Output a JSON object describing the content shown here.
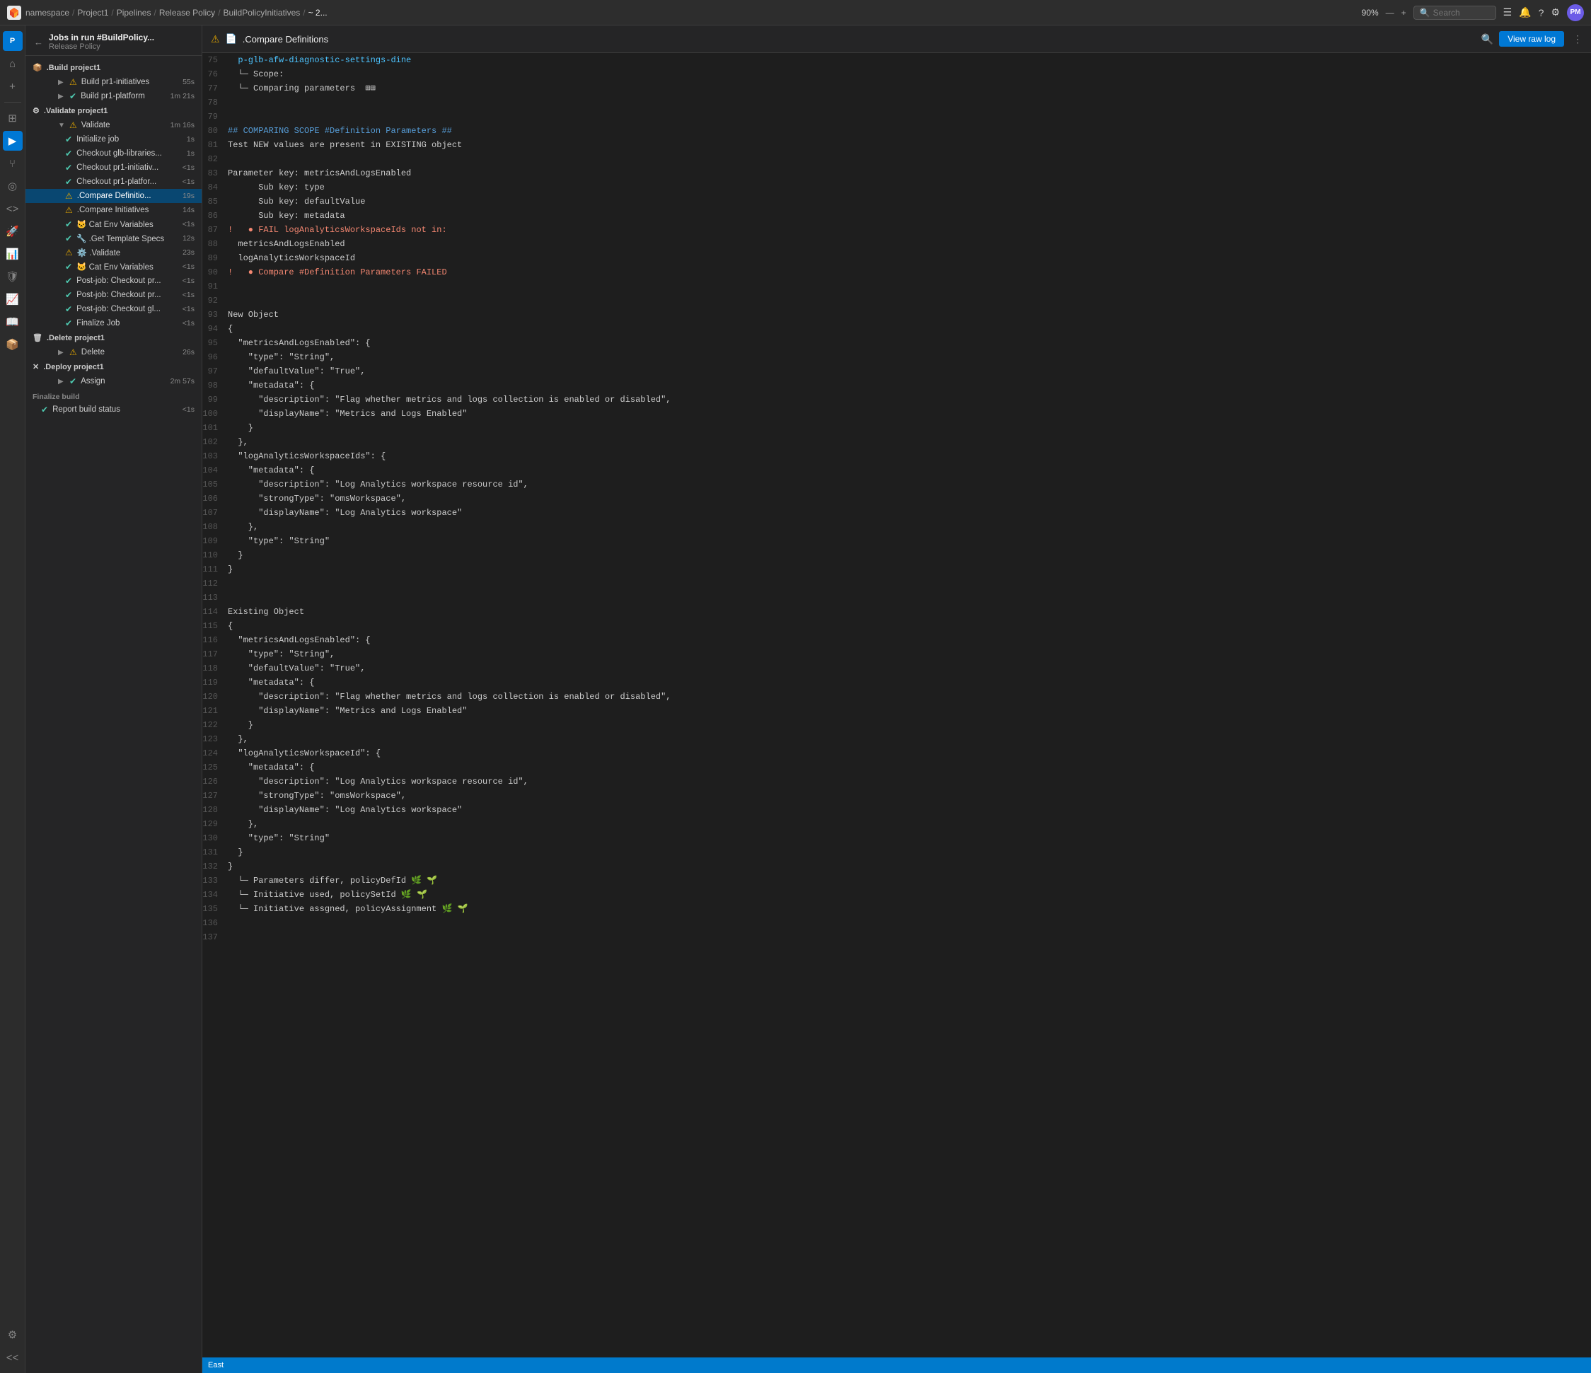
{
  "topbar": {
    "logo": "GL",
    "breadcrumb": [
      {
        "label": "namespace",
        "href": "#"
      },
      {
        "label": "Project1",
        "href": "#"
      },
      {
        "label": "Pipelines",
        "href": "#"
      },
      {
        "label": "Release Policy",
        "href": "#"
      },
      {
        "label": "BuildPolicyInitiatives",
        "href": "#"
      },
      {
        "label": "~ 2...",
        "href": "#"
      }
    ],
    "zoom": "90%",
    "search_placeholder": "Search",
    "avatar": "PM"
  },
  "sidebar": {
    "back_label": "←",
    "title": "Jobs in run #BuildPolicy...",
    "subtitle": "Release Policy",
    "groups": [
      {
        "name": "build_project1",
        "label": ".Build project1",
        "icon": "📦",
        "expanded": false,
        "jobs": [
          {
            "name": "Build pr1-initiatives",
            "status": "warn",
            "duration": "55s",
            "indent": 1
          },
          {
            "name": "Build pr1-platform",
            "status": "ok",
            "duration": "1m 21s",
            "indent": 1
          }
        ]
      },
      {
        "name": "validate_project1",
        "label": ".Validate project1",
        "icon": "⚙️",
        "expanded": true,
        "jobs": [
          {
            "name": "Validate",
            "status": "warn",
            "duration": "1m 16s",
            "indent": 1,
            "expand": true
          },
          {
            "name": "Initialize job",
            "status": "ok",
            "duration": "1s",
            "indent": 2
          },
          {
            "name": "Checkout glb-libraries...",
            "status": "ok",
            "duration": "1s",
            "indent": 2
          },
          {
            "name": "Checkout pr1-initiativ...",
            "status": "ok",
            "duration": "<1s",
            "indent": 2
          },
          {
            "name": "Checkout pr1-platfor...",
            "status": "ok",
            "duration": "<1s",
            "indent": 2
          },
          {
            "name": ".Compare Definitio...",
            "status": "warn",
            "duration": "19s",
            "indent": 2,
            "active": true
          },
          {
            "name": ".Compare Initiatives",
            "status": "warn",
            "duration": "14s",
            "indent": 2
          },
          {
            "name": "🐱 Cat Env Variables",
            "status": "ok",
            "duration": "<1s",
            "indent": 2
          },
          {
            "name": "🔧 .Get Template Specs",
            "status": "ok",
            "duration": "12s",
            "indent": 2
          },
          {
            "name": "⚙️ .Validate",
            "status": "warn",
            "duration": "23s",
            "indent": 2
          },
          {
            "name": "🐱 Cat Env Variables",
            "status": "ok",
            "duration": "<1s",
            "indent": 2
          },
          {
            "name": "Post-job: Checkout pr...",
            "status": "ok",
            "duration": "<1s",
            "indent": 2
          },
          {
            "name": "Post-job: Checkout pr...",
            "status": "ok",
            "duration": "<1s",
            "indent": 2
          },
          {
            "name": "Post-job: Checkout gl...",
            "status": "ok",
            "duration": "<1s",
            "indent": 2
          },
          {
            "name": "Finalize Job",
            "status": "ok",
            "duration": "<1s",
            "indent": 2
          }
        ]
      },
      {
        "name": "delete_project1",
        "label": ".Delete project1",
        "icon": "🗑️",
        "expanded": false,
        "jobs": [
          {
            "name": "Delete",
            "status": "warn",
            "duration": "26s",
            "indent": 1
          }
        ]
      },
      {
        "name": "deploy_project1",
        "label": ".Deploy project1",
        "icon": "✕",
        "expanded": false,
        "jobs": [
          {
            "name": "Assign",
            "status": "ok",
            "duration": "2m 57s",
            "indent": 1
          }
        ]
      }
    ],
    "finalize": {
      "label": "Finalize build",
      "jobs": [
        {
          "name": "Report build status",
          "status": "ok",
          "duration": "<1s"
        }
      ]
    }
  },
  "content": {
    "title": ".Compare Definitions",
    "view_raw_label": "View raw log",
    "lines": [
      {
        "num": 75,
        "text": "  p-glb-afw-diagnostic-settings-dine",
        "style": "link"
      },
      {
        "num": 76,
        "text": "  └─ Scope:",
        "style": "normal"
      },
      {
        "num": 77,
        "text": "  └─ Comparing parameters  ⊞⊞",
        "style": "normal"
      },
      {
        "num": 78,
        "text": "",
        "style": "normal"
      },
      {
        "num": 79,
        "text": "",
        "style": "normal"
      },
      {
        "num": 80,
        "text": "## COMPARING SCOPE #Definition Parameters ##",
        "style": "blue"
      },
      {
        "num": 81,
        "text": "Test NEW values are present in EXISTING object",
        "style": "normal"
      },
      {
        "num": 82,
        "text": "",
        "style": "normal"
      },
      {
        "num": 83,
        "text": "Parameter key: metricsAndLogsEnabled",
        "style": "normal"
      },
      {
        "num": 84,
        "text": "      Sub key: type",
        "style": "normal"
      },
      {
        "num": 85,
        "text": "      Sub key: defaultValue",
        "style": "normal"
      },
      {
        "num": 86,
        "text": "      Sub key: metadata",
        "style": "normal"
      },
      {
        "num": 87,
        "text": "!   ● FAIL logAnalyticsWorkspaceIds not in:",
        "style": "err"
      },
      {
        "num": 88,
        "text": "  metricsAndLogsEnabled",
        "style": "normal"
      },
      {
        "num": 89,
        "text": "  logAnalyticsWorkspaceId",
        "style": "normal"
      },
      {
        "num": 90,
        "text": "!   ● Compare #Definition Parameters FAILED",
        "style": "err"
      },
      {
        "num": 91,
        "text": "",
        "style": "normal"
      },
      {
        "num": 92,
        "text": "",
        "style": "normal"
      },
      {
        "num": 93,
        "text": "New Object",
        "style": "normal"
      },
      {
        "num": 94,
        "text": "{",
        "style": "normal"
      },
      {
        "num": 95,
        "text": "  \"metricsAndLogsEnabled\": {",
        "style": "normal"
      },
      {
        "num": 96,
        "text": "    \"type\": \"String\",",
        "style": "normal"
      },
      {
        "num": 97,
        "text": "    \"defaultValue\": \"True\",",
        "style": "normal"
      },
      {
        "num": 98,
        "text": "    \"metadata\": {",
        "style": "normal"
      },
      {
        "num": 99,
        "text": "      \"description\": \"Flag whether metrics and logs collection is enabled or disabled\",",
        "style": "normal"
      },
      {
        "num": 100,
        "text": "      \"displayName\": \"Metrics and Logs Enabled\"",
        "style": "normal"
      },
      {
        "num": 101,
        "text": "    }",
        "style": "normal"
      },
      {
        "num": 102,
        "text": "  },",
        "style": "normal"
      },
      {
        "num": 103,
        "text": "  \"logAnalyticsWorkspaceIds\": {",
        "style": "normal"
      },
      {
        "num": 104,
        "text": "    \"metadata\": {",
        "style": "normal"
      },
      {
        "num": 105,
        "text": "      \"description\": \"Log Analytics workspace resource id\",",
        "style": "normal"
      },
      {
        "num": 106,
        "text": "      \"strongType\": \"omsWorkspace\",",
        "style": "normal"
      },
      {
        "num": 107,
        "text": "      \"displayName\": \"Log Analytics workspace\"",
        "style": "normal"
      },
      {
        "num": 108,
        "text": "    },",
        "style": "normal"
      },
      {
        "num": 109,
        "text": "    \"type\": \"String\"",
        "style": "normal"
      },
      {
        "num": 110,
        "text": "  }",
        "style": "normal"
      },
      {
        "num": 111,
        "text": "}",
        "style": "normal"
      },
      {
        "num": 112,
        "text": "",
        "style": "normal"
      },
      {
        "num": 113,
        "text": "",
        "style": "normal"
      },
      {
        "num": 114,
        "text": "Existing Object",
        "style": "normal"
      },
      {
        "num": 115,
        "text": "{",
        "style": "normal"
      },
      {
        "num": 116,
        "text": "  \"metricsAndLogsEnabled\": {",
        "style": "normal"
      },
      {
        "num": 117,
        "text": "    \"type\": \"String\",",
        "style": "normal"
      },
      {
        "num": 118,
        "text": "    \"defaultValue\": \"True\",",
        "style": "normal"
      },
      {
        "num": 119,
        "text": "    \"metadata\": {",
        "style": "normal"
      },
      {
        "num": 120,
        "text": "      \"description\": \"Flag whether metrics and logs collection is enabled or disabled\",",
        "style": "normal"
      },
      {
        "num": 121,
        "text": "      \"displayName\": \"Metrics and Logs Enabled\"",
        "style": "normal"
      },
      {
        "num": 122,
        "text": "    }",
        "style": "normal"
      },
      {
        "num": 123,
        "text": "  },",
        "style": "normal"
      },
      {
        "num": 124,
        "text": "  \"logAnalyticsWorkspaceId\": {",
        "style": "normal"
      },
      {
        "num": 125,
        "text": "    \"metadata\": {",
        "style": "normal"
      },
      {
        "num": 126,
        "text": "      \"description\": \"Log Analytics workspace resource id\",",
        "style": "normal"
      },
      {
        "num": 127,
        "text": "      \"strongType\": \"omsWorkspace\",",
        "style": "normal"
      },
      {
        "num": 128,
        "text": "      \"displayName\": \"Log Analytics workspace\"",
        "style": "normal"
      },
      {
        "num": 129,
        "text": "    },",
        "style": "normal"
      },
      {
        "num": 130,
        "text": "    \"type\": \"String\"",
        "style": "normal"
      },
      {
        "num": 131,
        "text": "  }",
        "style": "normal"
      },
      {
        "num": 132,
        "text": "}",
        "style": "normal"
      },
      {
        "num": 133,
        "text": "  └─ Parameters differ, policyDefId 🌿 🌱",
        "style": "normal"
      },
      {
        "num": 134,
        "text": "  └─ Initiative used, policySetId 🌿 🌱",
        "style": "normal"
      },
      {
        "num": 135,
        "text": "  └─ Initiative assgned, policyAssignment 🌿 🌱",
        "style": "normal"
      },
      {
        "num": 136,
        "text": "",
        "style": "normal"
      },
      {
        "num": 137,
        "text": "",
        "style": "normal"
      }
    ]
  },
  "bottom_bar": {
    "item1": "East"
  }
}
